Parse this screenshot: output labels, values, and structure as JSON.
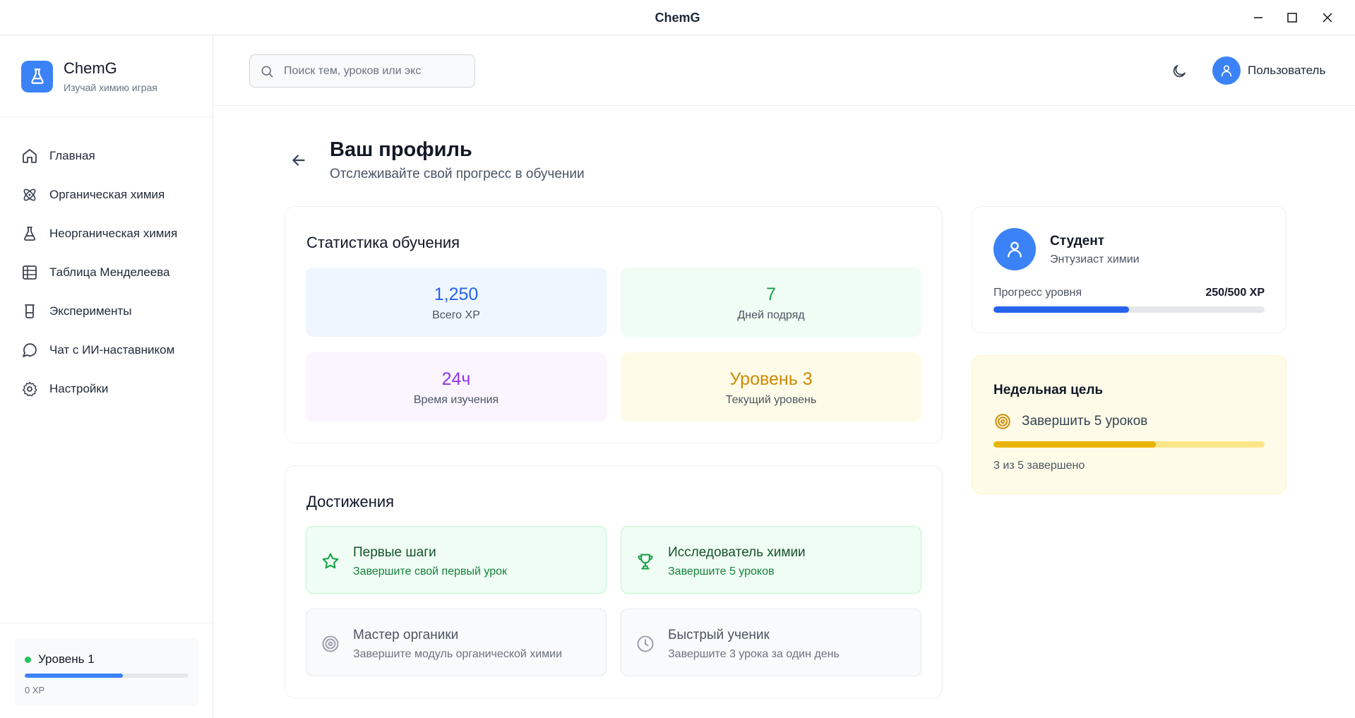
{
  "window": {
    "title": "ChemG"
  },
  "brand": {
    "name": "ChemG",
    "tagline": "Изучай химию играя"
  },
  "nav": {
    "items": [
      {
        "label": "Главная",
        "icon": "home-icon"
      },
      {
        "label": "Органическая химия",
        "icon": "atom-icon"
      },
      {
        "label": "Неорганическая химия",
        "icon": "flask-icon"
      },
      {
        "label": "Таблица Менделеева",
        "icon": "grid-icon"
      },
      {
        "label": "Эксперименты",
        "icon": "beaker-icon"
      },
      {
        "label": "Чат с ИИ-наставником",
        "icon": "chat-icon"
      },
      {
        "label": "Настройки",
        "icon": "gear-icon"
      }
    ]
  },
  "sidebar_level": {
    "label": "Уровень 1",
    "xp": "0 XP",
    "progress": 0.6
  },
  "header": {
    "search_placeholder": "Поиск тем, уроков или экс",
    "user_name": "Пользователь"
  },
  "page": {
    "title": "Ваш профиль",
    "subtitle": "Отслеживайте свой прогресс в обучении"
  },
  "stats": {
    "title": "Статистика обучения",
    "items": [
      {
        "value": "1,250",
        "label": "Всего XP",
        "color": "#2563eb",
        "bg": "#eff6ff"
      },
      {
        "value": "7",
        "label": "Дней подряд",
        "color": "#16a34a",
        "bg": "#f0fdf4"
      },
      {
        "value": "24ч",
        "label": "Время изучения",
        "color": "#9333ea",
        "bg": "#faf5ff"
      },
      {
        "value": "Уровень 3",
        "label": "Текущий уровень",
        "color": "#ca8a04",
        "bg": "#fefce8"
      }
    ]
  },
  "achievements": {
    "title": "Достижения",
    "items": [
      {
        "title": "Первые шаги",
        "desc": "Завершите свой первый урок",
        "icon": "star-icon",
        "unlocked": true
      },
      {
        "title": "Исследователь химии",
        "desc": "Завершите 5 уроков",
        "icon": "trophy-icon",
        "unlocked": true
      },
      {
        "title": "Мастер органики",
        "desc": "Завершите модуль органической химии",
        "icon": "target-icon",
        "unlocked": false
      },
      {
        "title": "Быстрый ученик",
        "desc": "Завершите 3 урока за один день",
        "icon": "clock-icon",
        "unlocked": false
      }
    ]
  },
  "profile": {
    "name": "Студент",
    "role": "Энтузиаст химии",
    "progress_label": "Прогресс уровня",
    "progress_value": "250/500 XP",
    "progress": 0.5
  },
  "weekly_goal": {
    "title": "Недельная цель",
    "goal": "Завершить 5 уроков",
    "status": "3 из 5 завершено",
    "progress": 0.6
  },
  "colors": {
    "accent": "#3b82f6",
    "success": "#22c55e",
    "warning": "#eab308"
  }
}
